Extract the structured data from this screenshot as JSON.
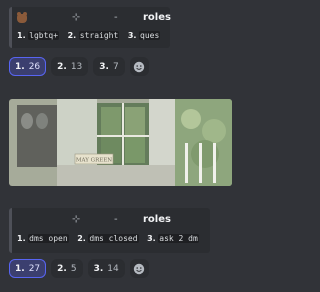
{
  "poll1": {
    "header": {
      "emoji": "bear-face-icon",
      "sep1": "⊹",
      "sep2": "-",
      "title": "roles"
    },
    "options": [
      {
        "num": "1.",
        "label": "lgbtq+"
      },
      {
        "num": "2.",
        "label": "straight"
      },
      {
        "num": "3.",
        "label": "ques"
      }
    ],
    "reactions": [
      {
        "num": "1.",
        "count": "26",
        "active": true
      },
      {
        "num": "2.",
        "count": "13",
        "active": false
      },
      {
        "num": "3.",
        "count": "7",
        "active": false
      }
    ]
  },
  "image": {
    "sign_text": "MAY GREEN"
  },
  "poll2": {
    "header": {
      "sep1": "⊹",
      "sep2": "-",
      "title": "roles"
    },
    "options": [
      {
        "num": "1.",
        "label": "dms open"
      },
      {
        "num": "2.",
        "label": "dms closed"
      },
      {
        "num": "3.",
        "label": "ask 2 dm"
      }
    ],
    "reactions": [
      {
        "num": "1.",
        "count": "27",
        "active": true
      },
      {
        "num": "2.",
        "count": "5",
        "active": false
      },
      {
        "num": "3.",
        "count": "14",
        "active": false
      }
    ]
  },
  "colors": {
    "accent": "#5865f2",
    "background": "#313338",
    "embed": "#2b2d31"
  }
}
